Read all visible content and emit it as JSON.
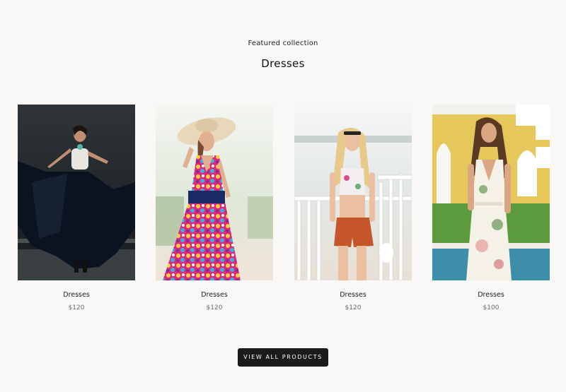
{
  "section": {
    "eyebrow": "Featured collection",
    "title": "Dresses"
  },
  "products": [
    {
      "name": "Dresses",
      "price": "$120"
    },
    {
      "name": "Dresses",
      "price": "$120"
    },
    {
      "name": "Dresses",
      "price": "$120"
    },
    {
      "name": "Dresses",
      "price": "$100"
    }
  ],
  "cta": {
    "label": "VIEW ALL PRODUCTS"
  }
}
